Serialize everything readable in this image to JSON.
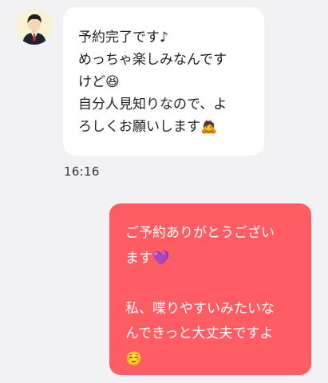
{
  "conversation": {
    "incoming": {
      "lines": [
        "予約完了です♪",
        "めっちゃ楽しみなんです",
        "けど😆",
        "自分人見知りなので、よ",
        "ろしくお願いします🙇"
      ],
      "timestamp": "16:16"
    },
    "outgoing": {
      "lines": [
        "ご予約ありがとうござい",
        "ます💜",
        "",
        "私、喋りやすいみたいな",
        "んできっと大丈夫ですよ",
        "☺️"
      ]
    }
  },
  "colors": {
    "background": "#f2f2f5",
    "incoming_bubble": "#ffffff",
    "outgoing_bubble": "#ff5c63",
    "avatar_background": "#f7f1d6"
  }
}
